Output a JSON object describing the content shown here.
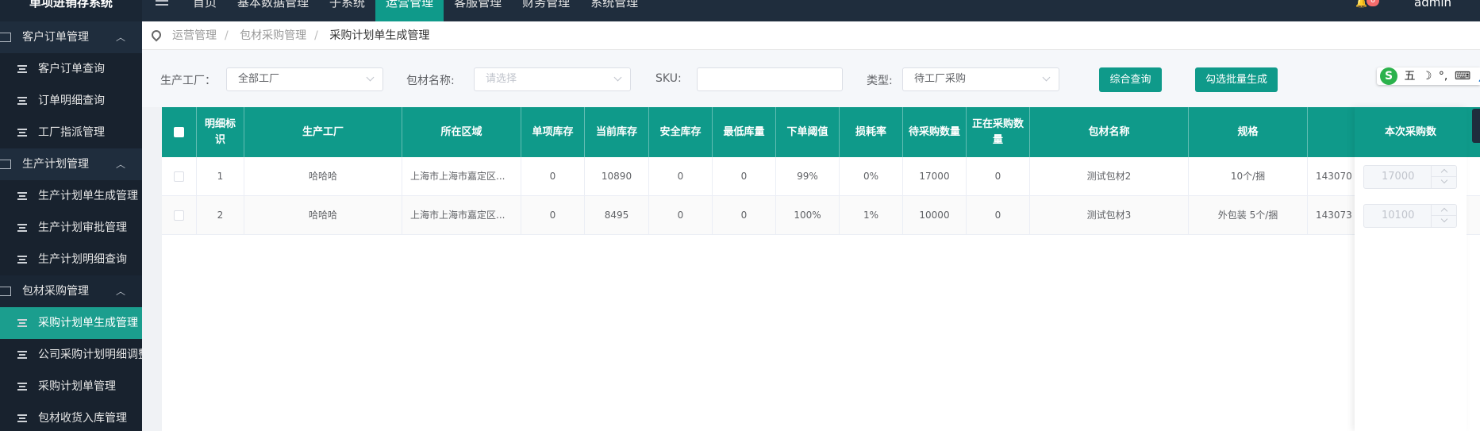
{
  "app": {
    "title": "单项进销存系统",
    "user": "admin",
    "notification_count": "0"
  },
  "topnav": [
    {
      "label": "首页"
    },
    {
      "label": "基本数据管理"
    },
    {
      "label": "子系统"
    },
    {
      "label": "运营管理",
      "active": true
    },
    {
      "label": "客服管理"
    },
    {
      "label": "财务管理"
    },
    {
      "label": "系统管理"
    }
  ],
  "sidebar": {
    "groups": [
      {
        "label": "客户订单管理",
        "items": [
          "客户订单查询",
          "订单明细查询",
          "工厂指派管理"
        ]
      },
      {
        "label": "生产计划管理",
        "items": [
          "生产计划单生成管理",
          "生产计划审批管理",
          "生产计划明细查询"
        ]
      },
      {
        "label": "包材采购管理",
        "items": [
          "采购计划单生成管理",
          "公司采购计划明细调整",
          "采购计划单管理",
          "包材收货入库管理"
        ]
      }
    ],
    "active_item": "采购计划单生成管理"
  },
  "breadcrumb": [
    "运营管理",
    "包材采购管理",
    "采购计划单生成管理"
  ],
  "filters": {
    "factory_label": "生产工厂：",
    "factory_value": "全部工厂",
    "material_label": "包材名称:",
    "material_placeholder": "请选择",
    "sku_label": "SKU:",
    "sku_value": "",
    "type_label": "类型:",
    "type_value": "待工厂采购",
    "search_button": "综合查询",
    "batch_button": "勾选批量生成"
  },
  "ime_toolbar": {
    "logo": "S",
    "mode": "五",
    "items": [
      "☽",
      "°,",
      "⌨",
      "👤"
    ]
  },
  "table": {
    "columns": [
      "明细标识",
      "生产工厂",
      "所在区域",
      "单项库存",
      "当前库存",
      "安全库存",
      "最低库量",
      "下单阈值",
      "损耗率",
      "待采购数量",
      "正在采购数量",
      "包材名称",
      "规格",
      "",
      "本次采购数"
    ],
    "rows": [
      {
        "id": "1",
        "factory": "哈哈哈",
        "region": "上海市上海市嘉定区...",
        "single_stock": "0",
        "current_stock": "10890",
        "safety_stock": "0",
        "min_stock": "0",
        "threshold": "99%",
        "loss_rate": "0%",
        "pending_qty": "17000",
        "purchasing_qty": "0",
        "material": "测试包材2",
        "spec": "10个/捆",
        "code": "143070",
        "purchase_qty": "17000"
      },
      {
        "id": "2",
        "factory": "哈哈哈",
        "region": "上海市上海市嘉定区...",
        "single_stock": "0",
        "current_stock": "8495",
        "safety_stock": "0",
        "min_stock": "0",
        "threshold": "100%",
        "loss_rate": "1%",
        "pending_qty": "10000",
        "purchasing_qty": "0",
        "material": "测试包材3",
        "spec": "外包装 5个/捆",
        "code": "143073",
        "purchase_qty": "10100"
      }
    ]
  },
  "colors": {
    "accent": "#0f9a8a",
    "sidebar": "#1f2d3d",
    "badge": "#f56c6c"
  }
}
